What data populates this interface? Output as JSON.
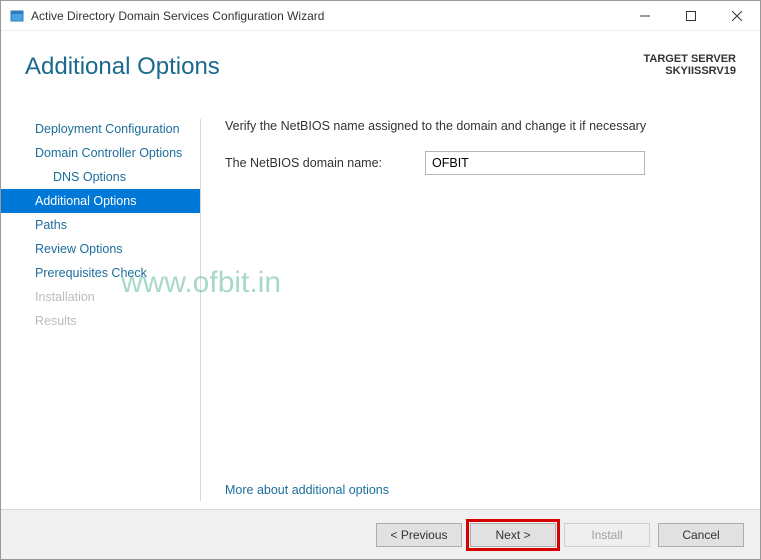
{
  "window": {
    "title": "Active Directory Domain Services Configuration Wizard"
  },
  "header": {
    "title": "Additional Options",
    "target_label": "TARGET SERVER",
    "target_server": "SKYIISSRV19"
  },
  "sidebar": {
    "steps": [
      {
        "label": "Deployment Configuration",
        "state": "done"
      },
      {
        "label": "Domain Controller Options",
        "state": "done"
      },
      {
        "label": "DNS Options",
        "state": "done",
        "sub": true
      },
      {
        "label": "Additional Options",
        "state": "current"
      },
      {
        "label": "Paths",
        "state": "done"
      },
      {
        "label": "Review Options",
        "state": "done"
      },
      {
        "label": "Prerequisites Check",
        "state": "done"
      },
      {
        "label": "Installation",
        "state": "disabled"
      },
      {
        "label": "Results",
        "state": "disabled"
      }
    ]
  },
  "pane": {
    "instruction": "Verify the NetBIOS name assigned to the domain and change it if necessary",
    "netbios_label": "The NetBIOS domain name:",
    "netbios_value": "OFBIT",
    "more_link": "More about additional options"
  },
  "footer": {
    "previous": "< Previous",
    "next": "Next >",
    "install": "Install",
    "cancel": "Cancel"
  },
  "watermark": "www.ofbit.in"
}
